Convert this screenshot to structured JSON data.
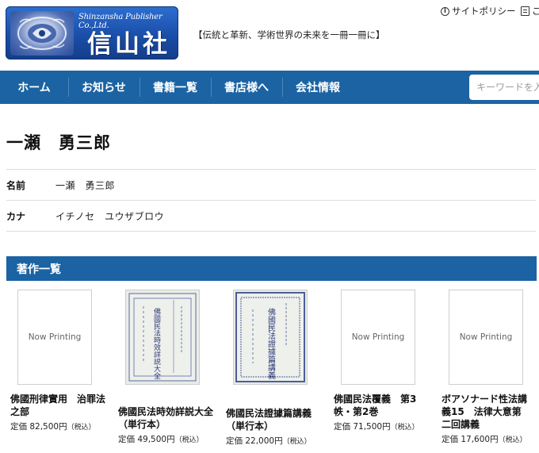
{
  "header": {
    "logo_en": "Shinzansha Publisher Co.,Ltd.",
    "logo_ja": "信山社",
    "tagline": "【伝統と革新、学術世界の未来を一冊一冊に】",
    "util_links": [
      {
        "label": "サイトポリシー",
        "icon": "info-icon"
      },
      {
        "label": "こ",
        "icon": "document-icon"
      }
    ]
  },
  "nav": {
    "items": [
      "ホーム",
      "お知らせ",
      "書籍一覧",
      "書店様へ",
      "会社情報"
    ],
    "search_placeholder": "キーワードを入"
  },
  "author": {
    "heading": "一瀬　勇三郎",
    "rows": [
      {
        "key": "名前",
        "value": "一瀬　勇三郎"
      },
      {
        "key": "カナ",
        "value": "イチノセ　ユウザブロウ"
      }
    ]
  },
  "works": {
    "heading": "著作一覧",
    "books": [
      {
        "title": "佛國刑律實用　治罪法之部",
        "price": "定価 82,500円",
        "tax": "（税込）",
        "cover": "Now Printing"
      },
      {
        "title": "佛國民法時効詳説大全（単行本）",
        "price": "定価 49,500円",
        "tax": "（税込）",
        "cover_text": "佛國民法時效詳説大全"
      },
      {
        "title": "佛國民法證據篇講義（単行本）",
        "price": "定価 22,000円",
        "tax": "（税込）",
        "cover_text": "佛國民法證據篇講義"
      },
      {
        "title": "佛國民法覆義　第3帙・第2巻",
        "price": "定価 71,500円",
        "tax": "（税込）",
        "cover": "Now Printing"
      },
      {
        "title": "ボアソナード性法講義15　法律大意第二回講義",
        "price": "定価 17,600円",
        "tax": "（税込）",
        "cover": "Now Printing"
      }
    ]
  },
  "colors": {
    "brand_blue": "#1b63a3"
  }
}
